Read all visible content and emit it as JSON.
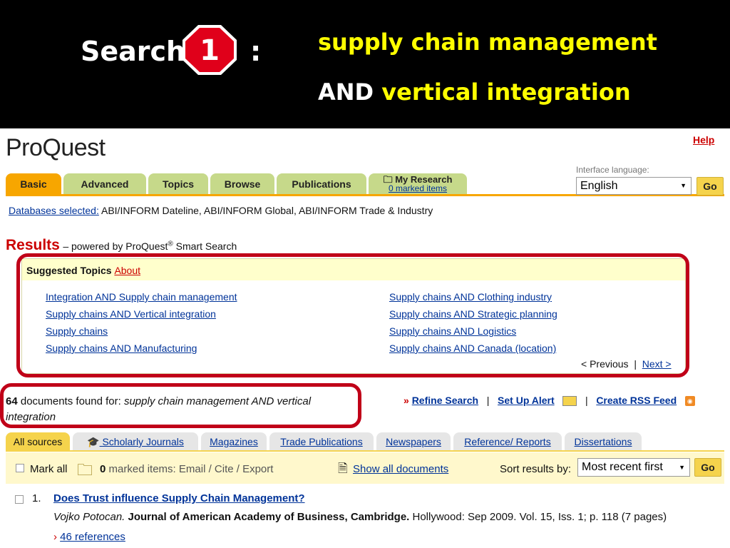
{
  "banner": {
    "search_word": "Search",
    "stop_number": "1",
    "colon": ":",
    "query_line1": "supply chain management",
    "query_and": "AND",
    "query_line2": "vertical integration"
  },
  "header": {
    "logo": "ProQuest",
    "help": "Help"
  },
  "tabs": [
    {
      "label": "Basic"
    },
    {
      "label": "Advanced"
    },
    {
      "label": "Topics"
    },
    {
      "label": "Browse"
    },
    {
      "label": "Publications"
    }
  ],
  "my_research": {
    "label": "My Research",
    "marked": "0 marked items"
  },
  "language": {
    "label": "Interface language:",
    "value": "English",
    "go": "Go"
  },
  "databases": {
    "label": "Databases selected:",
    "value": "ABI/INFORM Dateline, ABI/INFORM Global, ABI/INFORM Trade & Industry"
  },
  "results": {
    "title": "Results",
    "powered_prefix": "– powered by ProQuest",
    "reg_mark": "®",
    "powered_suffix": " Smart Search"
  },
  "suggested": {
    "title": "Suggested Topics",
    "about": "About",
    "left": [
      "Integration AND Supply chain management",
      "Supply chains AND Vertical integration",
      "Supply chains",
      "Supply chains AND Manufacturing"
    ],
    "right": [
      "Supply chains AND Clothing industry",
      "Supply chains AND Strategic planning",
      "Supply chains AND Logistics",
      "Supply chains AND Canada (location)"
    ],
    "previous": "< Previous",
    "separator": "|",
    "next": "Next >"
  },
  "found": {
    "count": "64",
    "text": " documents found for: ",
    "query": "supply chain management AND vertical integration"
  },
  "actions": {
    "arrow": "»",
    "refine": "Refine Search",
    "alert": "Set Up Alert",
    "rss": "Create RSS Feed",
    "sep": "|"
  },
  "source_tabs": [
    {
      "label": "All sources"
    },
    {
      "label": "Scholarly Journals"
    },
    {
      "label": "Magazines"
    },
    {
      "label": "Trade Publications"
    },
    {
      "label": "Newspapers"
    },
    {
      "label": "Reference/ Reports"
    },
    {
      "label": "Dissertations"
    }
  ],
  "markbar": {
    "mark_all": "Mark all",
    "marked_count": "0",
    "marked_text": "marked items:",
    "email_cite": "Email / Cite / Export",
    "show_all": "Show all documents",
    "sort_label": "Sort results by:",
    "sort_value": "Most recent first",
    "go": "Go"
  },
  "document": {
    "number": "1.",
    "title": "Does Trust influence Supply Chain Management?",
    "author": "Vojko Potocan.",
    "journal": "Journal of American Academy of Business, Cambridge.",
    "details": " Hollywood: Sep 2009. Vol. 15, Iss. 1; p. 118 (7 pages)",
    "refs_arrow": "›",
    "refs": "46 references"
  },
  "colors": {
    "highlight_red": "#c00018",
    "tab_green": "#c6d98a",
    "tab_orange": "#f7a600",
    "link_blue": "#003399",
    "query_yellow": "#ffff00"
  }
}
